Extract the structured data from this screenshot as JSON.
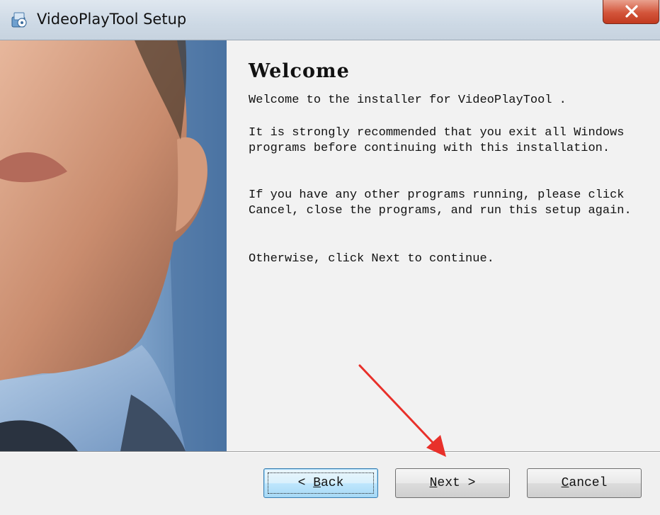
{
  "window": {
    "title": "VideoPlayTool Setup",
    "app_icon": "installer-icon",
    "close_icon": "close-icon"
  },
  "content": {
    "heading": "Welcome",
    "paragraphs": [
      "Welcome to the installer for VideoPlayTool .",
      "It is strongly recommended that you exit all Windows programs before continuing with this installation.",
      "If you have any other programs running, please click Cancel, close the programs, and run this setup again.",
      "Otherwise, click Next to continue."
    ]
  },
  "buttons": {
    "back_prefix": "< ",
    "back_accel": "B",
    "back_rest": "ack",
    "next_accel": "N",
    "next_rest": "ext >",
    "cancel_accel": "C",
    "cancel_rest": "ancel"
  },
  "annotation": {
    "arrow_color": "#e8302a"
  }
}
